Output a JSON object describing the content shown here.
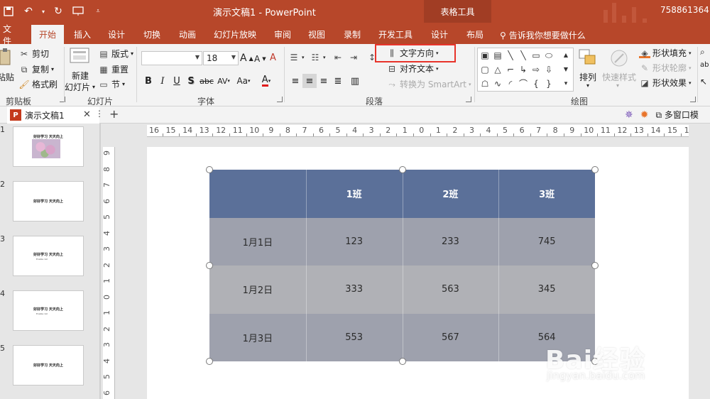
{
  "window": {
    "title": "演示文稿1  -  PowerPoint",
    "context_tools": "表格工具",
    "user": "758861364"
  },
  "tabs": [
    "文件",
    "开始",
    "插入",
    "设计",
    "切换",
    "动画",
    "幻灯片放映",
    "审阅",
    "视图",
    "录制",
    "开发工具",
    "设计",
    "布局"
  ],
  "active_tab": "开始",
  "tell_me": "告诉我你想要做什么",
  "ribbon": {
    "clipboard": {
      "paste": "粘贴",
      "cut": "剪切",
      "copy": "复制",
      "format_painter": "格式刷",
      "label": "剪贴板"
    },
    "slides": {
      "new_slide_line1": "新建",
      "new_slide_line2": "幻灯片",
      "layout": "版式",
      "reset": "重置",
      "section": "节",
      "label": "幻灯片"
    },
    "font": {
      "font_name": "",
      "font_size": "18",
      "label": "字体",
      "grow": "A",
      "shrink": "A",
      "clear": "A",
      "bold": "B",
      "italic": "I",
      "underline": "U",
      "shadow": "S",
      "strike": "abc",
      "spacing": "AV",
      "case": "Aa",
      "color": "A"
    },
    "paragraph": {
      "text_direction": "文字方向",
      "align_text": "对齐文本",
      "convert_smartart": "转换为 SmartArt",
      "label": "段落"
    },
    "drawing": {
      "arrange": "排列",
      "quick_styles": "快速样式",
      "shape_fill": "形状填充",
      "shape_outline": "形状轮廓",
      "shape_effects": "形状效果",
      "label": "绘图"
    }
  },
  "doc_tab": {
    "name": "演示文稿1",
    "ppt_icon": "P"
  },
  "multi_window": "多窗口模",
  "thumbnails": [
    {
      "num": "1",
      "title": "好好学习 天天向上",
      "sub": ""
    },
    {
      "num": "2",
      "title": "好好学习 天天向上",
      "sub": ""
    },
    {
      "num": "3",
      "title": "好好学习 天天向上",
      "sub": "Enable 1st"
    },
    {
      "num": "4",
      "title": "好好学习 天天向上",
      "sub": "Enable 1st"
    },
    {
      "num": "5",
      "title": "好好学习 天天向上",
      "sub": ""
    }
  ],
  "ruler_h": [
    "16",
    "15",
    "14",
    "13",
    "12",
    "11",
    "10",
    "9",
    "8",
    "7",
    "6",
    "5",
    "4",
    "3",
    "2",
    "1",
    "0",
    "1",
    "2",
    "3",
    "4",
    "5",
    "6",
    "7",
    "8",
    "9",
    "10",
    "11",
    "12",
    "13",
    "14",
    "15",
    "16"
  ],
  "ruler_v": [
    "9",
    "8",
    "7",
    "6",
    "5",
    "4",
    "3",
    "2",
    "1",
    "0",
    "1",
    "2",
    "3",
    "4",
    "5",
    "6"
  ],
  "table": {
    "header": [
      "",
      "1班",
      "2班",
      "3班"
    ],
    "rows": [
      [
        "1月1日",
        "123",
        "233",
        "745"
      ],
      [
        "1月2日",
        "333",
        "563",
        "345"
      ],
      [
        "1月3日",
        "553",
        "567",
        "564"
      ]
    ],
    "colors": {
      "header": "#5b7099",
      "row_dark": "#9ea1ad",
      "row_light": "#b0b1b6"
    }
  },
  "watermark": {
    "brand": "Bai经验",
    "site": "jingyan.baidu.com"
  },
  "colors": {
    "accent": "#b7472a",
    "highlight": "#e8332a"
  }
}
